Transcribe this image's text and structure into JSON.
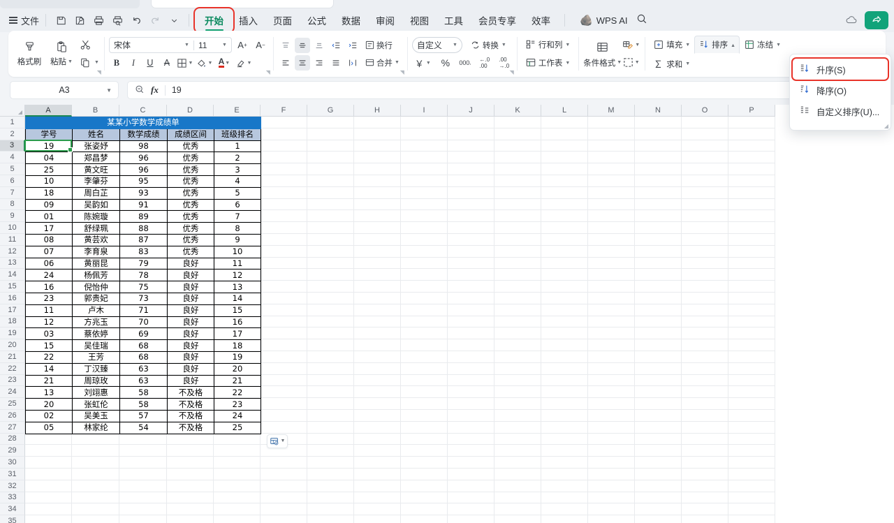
{
  "menubar": {
    "file_label": "文件",
    "quick_access": [
      {
        "name": "save-icon",
        "title": "保存"
      },
      {
        "name": "save-as-icon",
        "title": "另存为"
      },
      {
        "name": "print-icon",
        "title": "打印"
      },
      {
        "name": "print-preview-icon",
        "title": "打印预览"
      },
      {
        "name": "undo-icon",
        "title": "撤销"
      },
      {
        "name": "redo-icon",
        "title": "恢复"
      },
      {
        "name": "chevron-down-icon",
        "title": "更多"
      }
    ],
    "tabs": [
      {
        "label": "开始",
        "active": true,
        "highlighted": true
      },
      {
        "label": "插入",
        "active": false,
        "highlighted": false
      },
      {
        "label": "页面",
        "active": false,
        "highlighted": false
      },
      {
        "label": "公式",
        "active": false,
        "highlighted": false
      },
      {
        "label": "数据",
        "active": false,
        "highlighted": false
      },
      {
        "label": "审阅",
        "active": false,
        "highlighted": false
      },
      {
        "label": "视图",
        "active": false,
        "highlighted": false
      },
      {
        "label": "工具",
        "active": false,
        "highlighted": false
      },
      {
        "label": "会员专享",
        "active": false,
        "highlighted": false
      },
      {
        "label": "效率",
        "active": false,
        "highlighted": false
      }
    ],
    "ai_label": "WPS AI",
    "search_icon": "search-icon",
    "cloud_icon": "cloud-icon",
    "share_icon": "share-icon"
  },
  "ribbon": {
    "clipboard": {
      "format_painter": "格式刷",
      "paste": "粘贴",
      "cut_icon": "scissors-icon",
      "copy_icon": "copy-icon"
    },
    "font": {
      "name": "宋体",
      "size": "11",
      "grow_label": "A⁺",
      "shrink_label": "A⁻",
      "bold": "B",
      "italic": "I",
      "underline": "U",
      "strikethrough": "A",
      "border_icon": "border-icon",
      "fill_icon": "fill-color-icon",
      "font_color_icon": "font-color-icon",
      "clear_icon": "clear-format-icon"
    },
    "align": {
      "wrap_text": "换行",
      "merge": "合并"
    },
    "number": {
      "format": "自定义",
      "convert": "转换",
      "currency_icon": "currency-icon",
      "percent_icon": "percent-icon",
      "comma_icon": "comma-icon",
      "inc_decimal_icon": "increase-decimal-icon",
      "dec_decimal_icon": "decrease-decimal-icon"
    },
    "cells": {
      "rows_cols": "行和列",
      "worksheet": "工作表"
    },
    "styles": {
      "conditional_format": "条件格式",
      "cell_style_icon": "cell-style-icon",
      "table_style_icon": "table-style-icon"
    },
    "editing": {
      "fill": "填充",
      "sort": "排序",
      "freeze": "冻结",
      "sum": "求和"
    }
  },
  "sort_dropdown": {
    "visible": true,
    "items": [
      {
        "label": "升序(S)",
        "icon": "sort-ascending-icon",
        "highlighted": true
      },
      {
        "label": "降序(O)",
        "icon": "sort-descending-icon",
        "highlighted": false
      },
      {
        "label": "自定义排序(U)...",
        "icon": "custom-sort-icon",
        "highlighted": false
      }
    ]
  },
  "formula_bar": {
    "name_box": "A3",
    "zoom_icon": "zoom-out-icon",
    "fx_label": "fx",
    "value": "19"
  },
  "sheet": {
    "column_headers": [
      "A",
      "B",
      "C",
      "D",
      "E",
      "F",
      "G",
      "H",
      "I",
      "J",
      "K",
      "L",
      "M",
      "N",
      "O",
      "P"
    ],
    "selected_column": "A",
    "selected_row": 3,
    "row_numbers": [
      1,
      2,
      3,
      4,
      5,
      6,
      7,
      8,
      9,
      10,
      11,
      12,
      13,
      14,
      15,
      16,
      17,
      18,
      19,
      20,
      21,
      22,
      23,
      24,
      25,
      26,
      27,
      28,
      29,
      30,
      31,
      32,
      33,
      34,
      35
    ],
    "title_row": "某某小学数学成绩单",
    "title_bg": "#1877c8",
    "header_bg": "#b7c7de",
    "headers": [
      "学号",
      "姓名",
      "数学成绩",
      "成绩区间",
      "班级排名"
    ],
    "rows": [
      [
        "19",
        "张姿妤",
        "98",
        "优秀",
        "1"
      ],
      [
        "04",
        "郑昌梦",
        "96",
        "优秀",
        "2"
      ],
      [
        "25",
        "黄文旺",
        "96",
        "优秀",
        "3"
      ],
      [
        "10",
        "李肇芬",
        "95",
        "优秀",
        "4"
      ],
      [
        "18",
        "周白芷",
        "93",
        "优秀",
        "5"
      ],
      [
        "09",
        "吴韵如",
        "91",
        "优秀",
        "6"
      ],
      [
        "01",
        "陈婉璇",
        "89",
        "优秀",
        "7"
      ],
      [
        "17",
        "舒绿珮",
        "88",
        "优秀",
        "8"
      ],
      [
        "08",
        "黄芸欢",
        "87",
        "优秀",
        "9"
      ],
      [
        "07",
        "李育泉",
        "83",
        "优秀",
        "10"
      ],
      [
        "06",
        "黄丽昆",
        "79",
        "良好",
        "11"
      ],
      [
        "24",
        "杨佩芳",
        "78",
        "良好",
        "12"
      ],
      [
        "16",
        "倪怡仲",
        "75",
        "良好",
        "13"
      ],
      [
        "23",
        "郭贵妃",
        "73",
        "良好",
        "14"
      ],
      [
        "11",
        "卢木",
        "71",
        "良好",
        "15"
      ],
      [
        "12",
        "方兆玉",
        "70",
        "良好",
        "16"
      ],
      [
        "03",
        "蔡依婷",
        "69",
        "良好",
        "17"
      ],
      [
        "15",
        "吴佳瑞",
        "68",
        "良好",
        "18"
      ],
      [
        "22",
        "王芳",
        "68",
        "良好",
        "19"
      ],
      [
        "14",
        "丁汉臻",
        "63",
        "良好",
        "20"
      ],
      [
        "21",
        "周琼玫",
        "63",
        "良好",
        "21"
      ],
      [
        "13",
        "刘翊惠",
        "58",
        "不及格",
        "22"
      ],
      [
        "20",
        "张虹伦",
        "58",
        "不及格",
        "23"
      ],
      [
        "02",
        "吴美玉",
        "57",
        "不及格",
        "24"
      ],
      [
        "05",
        "林家纶",
        "54",
        "不及格",
        "25"
      ]
    ],
    "paste_options_icon": "paste-options-icon"
  }
}
